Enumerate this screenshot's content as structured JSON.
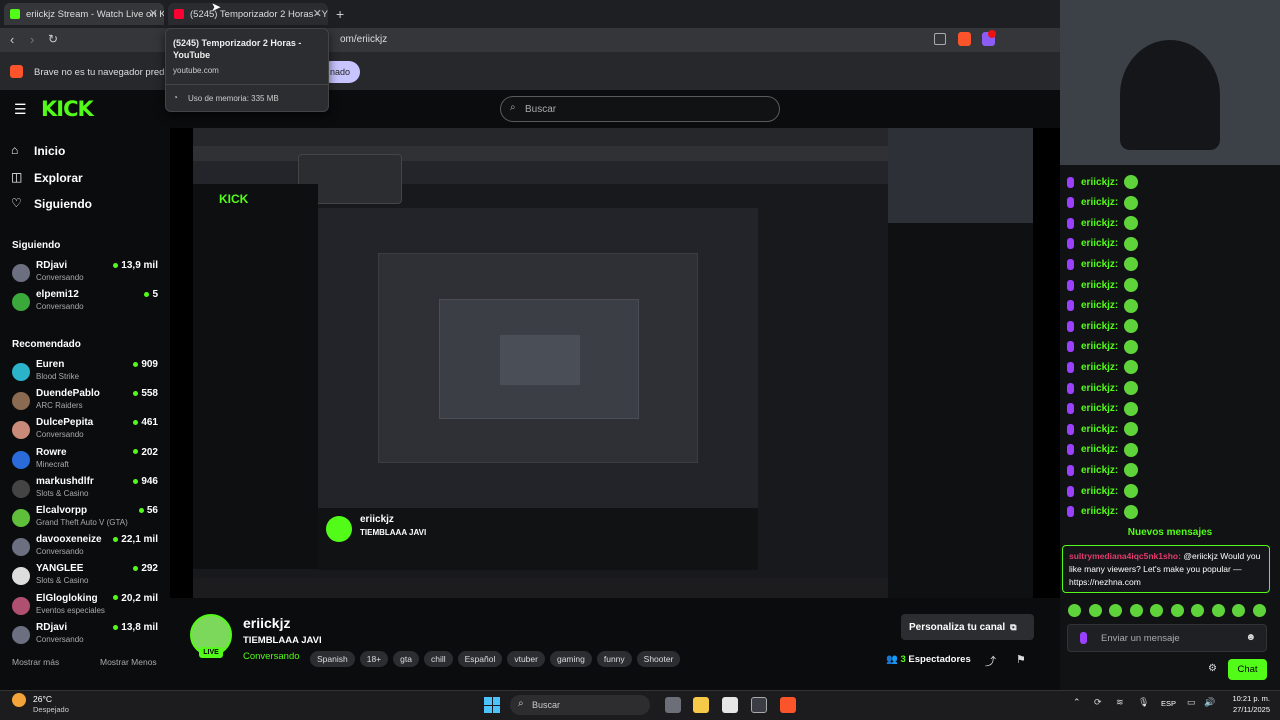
{
  "browser": {
    "tabs": [
      {
        "title": "eriickjz Stream - Watch Live on K"
      },
      {
        "title": "(5245) Temporizador 2 Horas - Y"
      }
    ],
    "url": "om/eriickjz",
    "info_text": "Brave no es tu navegador predete",
    "info_button": "nado",
    "tooltip": {
      "title": "(5245) Temporizador 2 Horas - YouTube",
      "domain": "youtube.com",
      "memory": "Uso de memoria: 335 MB"
    }
  },
  "kick": {
    "logo": "KICK",
    "search_placeholder": "Buscar",
    "nav": [
      {
        "label": "Inicio",
        "icon": "home-icon"
      },
      {
        "label": "Explorar",
        "icon": "compass-icon"
      },
      {
        "label": "Siguiendo",
        "icon": "heart-icon"
      }
    ],
    "following_header": "Siguiendo",
    "following": [
      {
        "name": "RDjavi",
        "sub": "Conversando",
        "viewers": "13,9 mil"
      },
      {
        "name": "elpemi12",
        "sub": "Conversando",
        "viewers": "5"
      }
    ],
    "recommended_header": "Recomendado",
    "recommended": [
      {
        "name": "Euren",
        "sub": "Blood Strike",
        "viewers": "909"
      },
      {
        "name": "DuendePablo",
        "sub": "ARC Raiders",
        "viewers": "558"
      },
      {
        "name": "DulcePepita",
        "sub": "Conversando",
        "viewers": "461"
      },
      {
        "name": "Rowre",
        "sub": "Minecraft",
        "viewers": "202"
      },
      {
        "name": "markushdlfr",
        "sub": "Slots & Casino",
        "viewers": "946"
      },
      {
        "name": "Elcalvorpp",
        "sub": "Grand Theft Auto V (GTA)",
        "viewers": "56"
      },
      {
        "name": "davooxeneize",
        "sub": "Conversando",
        "viewers": "22,1 mil"
      },
      {
        "name": "YANGLEE",
        "sub": "Slots & Casino",
        "viewers": "292"
      },
      {
        "name": "ElGlogloking",
        "sub": "Eventos especiales",
        "viewers": "20,2 mil"
      },
      {
        "name": "RDjavi",
        "sub": "Conversando",
        "viewers": "13,8 mil"
      }
    ],
    "show_more": "Mostrar más",
    "show_less": "Mostrar Menos"
  },
  "stream": {
    "channel": "eriickjz",
    "title": "TIEMBLAAA JAVI",
    "live": "LIVE",
    "category": "Conversando",
    "tags": [
      "Spanish",
      "18+",
      "gta",
      "chill",
      "Español",
      "vtuber",
      "gaming",
      "funny",
      "Shooter"
    ],
    "customize_button": "Personaliza tu canal",
    "viewers": "3",
    "viewers_label": "Espectadores"
  },
  "chat": {
    "username": "eriickjz:",
    "line_count": 17,
    "new_messages": "Nuevos mensajes",
    "pinned_user": "sultrymediana4iqc5nk1sho:",
    "pinned_message": "@eriickjz Would you like many viewers? Let's make you popular — https://nezhna.com",
    "input_placeholder": "Enviar un mensaje",
    "send_button": "Chat"
  },
  "taskbar": {
    "weather_temp": "26°C",
    "weather_desc": "Despejado",
    "search_placeholder": "Buscar",
    "lang": "ESP",
    "time": "10:21 p. m.",
    "date": "27/11/2025"
  },
  "colors": {
    "accent": "#53fc18",
    "purple": "#9c40ff",
    "bg": "#0b0c0e"
  }
}
